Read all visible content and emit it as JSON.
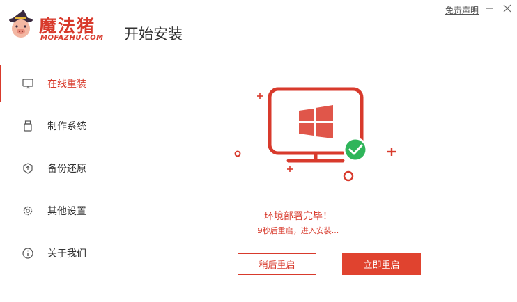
{
  "header": {
    "brand_name": "魔法猪",
    "brand_url": "MOFAZHU.COM",
    "page_title": "开始安装",
    "disclaimer": "免责声明"
  },
  "sidebar": {
    "items": [
      {
        "label": "在线重装",
        "icon": "monitor-icon",
        "active": true
      },
      {
        "label": "制作系统",
        "icon": "usb-drive-icon",
        "active": false
      },
      {
        "label": "备份还原",
        "icon": "backup-restore-icon",
        "active": false
      },
      {
        "label": "其他设置",
        "icon": "gear-icon",
        "active": false
      },
      {
        "label": "关于我们",
        "icon": "info-icon",
        "active": false
      }
    ]
  },
  "main": {
    "status_message": "环境部署完毕！",
    "status_sub": "9秒后重启，进入安装...",
    "later_button": "稍后重启",
    "now_button": "立即重启"
  },
  "colors": {
    "accent": "#d83a2c",
    "success": "#2fb55a"
  }
}
